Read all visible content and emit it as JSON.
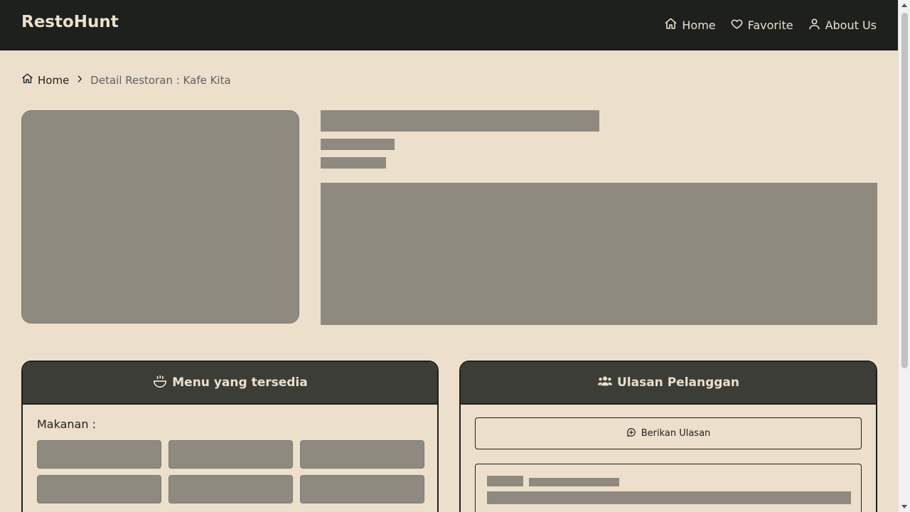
{
  "navbar": {
    "brand": "RestoHunt",
    "links": [
      {
        "label": "Home",
        "icon": "home-icon"
      },
      {
        "label": "Favorite",
        "icon": "heart-icon"
      },
      {
        "label": "About Us",
        "icon": "user-icon"
      }
    ]
  },
  "breadcrumb": {
    "home": "Home",
    "current": "Detail Restoran : Kafe Kita"
  },
  "menu_card": {
    "title": "Menu yang tersedia",
    "icon": "bowl-icon",
    "food_label": "Makanan :"
  },
  "review_card": {
    "title": "Ulasan Pelanggan",
    "icon": "users-icon",
    "add_review_label": "Berikan Ulasan"
  },
  "colors": {
    "navbar": "#1E201E",
    "background": "#ECDFCC",
    "card_header": "#3C3D37",
    "skeleton": "#8E8A7F"
  }
}
